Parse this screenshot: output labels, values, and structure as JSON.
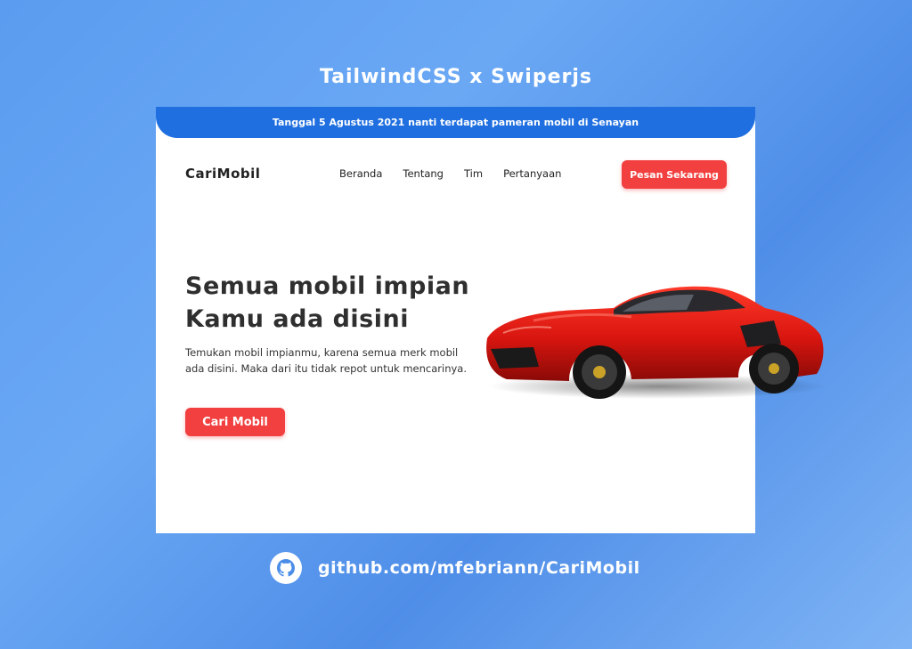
{
  "header": {
    "title": "TailwindCSS x Swiperjs"
  },
  "site": {
    "announcement": "Tanggal 5 Agustus 2021 nanti terdapat pameran mobil di Senayan",
    "brand": "CariMobil",
    "nav": [
      {
        "label": "Beranda"
      },
      {
        "label": "Tentang"
      },
      {
        "label": "Tim"
      },
      {
        "label": "Pertanyaan"
      }
    ],
    "cta_label": "Pesan Sekarang",
    "hero": {
      "title_line1": "Semua mobil impian",
      "title_line2": "Kamu ada disini",
      "description": "Temukan mobil impianmu, karena semua merk mobil ada disini.  Maka dari itu tidak repot untuk mencarinya.",
      "button_label": "Cari Mobil"
    }
  },
  "footer": {
    "link_text": "github.com/mfebriann/CariMobil",
    "icon": "github-icon"
  },
  "colors": {
    "accent_red": "#f23f3f",
    "bar_blue": "#1f6fe0",
    "car_red": "#d8150f"
  }
}
